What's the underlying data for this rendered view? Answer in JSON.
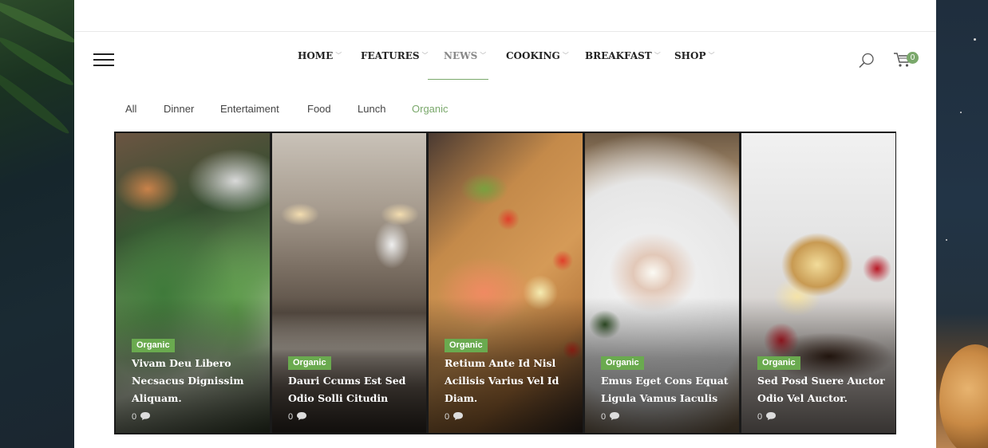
{
  "nav": {
    "items": [
      {
        "label": "HOME"
      },
      {
        "label": "FEATURES"
      },
      {
        "label": "NEWS"
      },
      {
        "label": "COOKING"
      },
      {
        "label": "BREAKFAST"
      },
      {
        "label": "SHOP"
      }
    ],
    "active": "NEWS"
  },
  "cart": {
    "count": "0"
  },
  "filters": {
    "items": [
      "All",
      "Dinner",
      "Entertaiment",
      "Food",
      "Lunch",
      "Organic"
    ],
    "active": "Organic"
  },
  "posts": [
    {
      "tag": "Organic",
      "title": "Vivam Deu Libero Necsacus Dignissim Aliquam.",
      "comments": "0",
      "image": "vegetables"
    },
    {
      "tag": "Organic",
      "title": "Dauri Ccums Est Sed Odio Solli Citudin",
      "comments": "0",
      "image": "kitchen"
    },
    {
      "tag": "Organic",
      "title": "Retium Ante Id Nisl Acilisis Varius Vel Id Diam.",
      "comments": "0",
      "image": "salmon"
    },
    {
      "tag": "Organic",
      "title": "Emus Eget Cons Equat Ligula Vamus Iaculis",
      "comments": "0",
      "image": "plate"
    },
    {
      "tag": "Organic",
      "title": "Sed Posd Suere Auctor Odio Vel Auctor.",
      "comments": "0",
      "image": "dessert"
    }
  ],
  "colors": {
    "accent": "#7aa86b",
    "tag": "#6aaa4f"
  },
  "icons": [
    "hamburger-menu-icon",
    "search-icon",
    "cart-icon",
    "chevron-down-icon",
    "comment-icon"
  ]
}
